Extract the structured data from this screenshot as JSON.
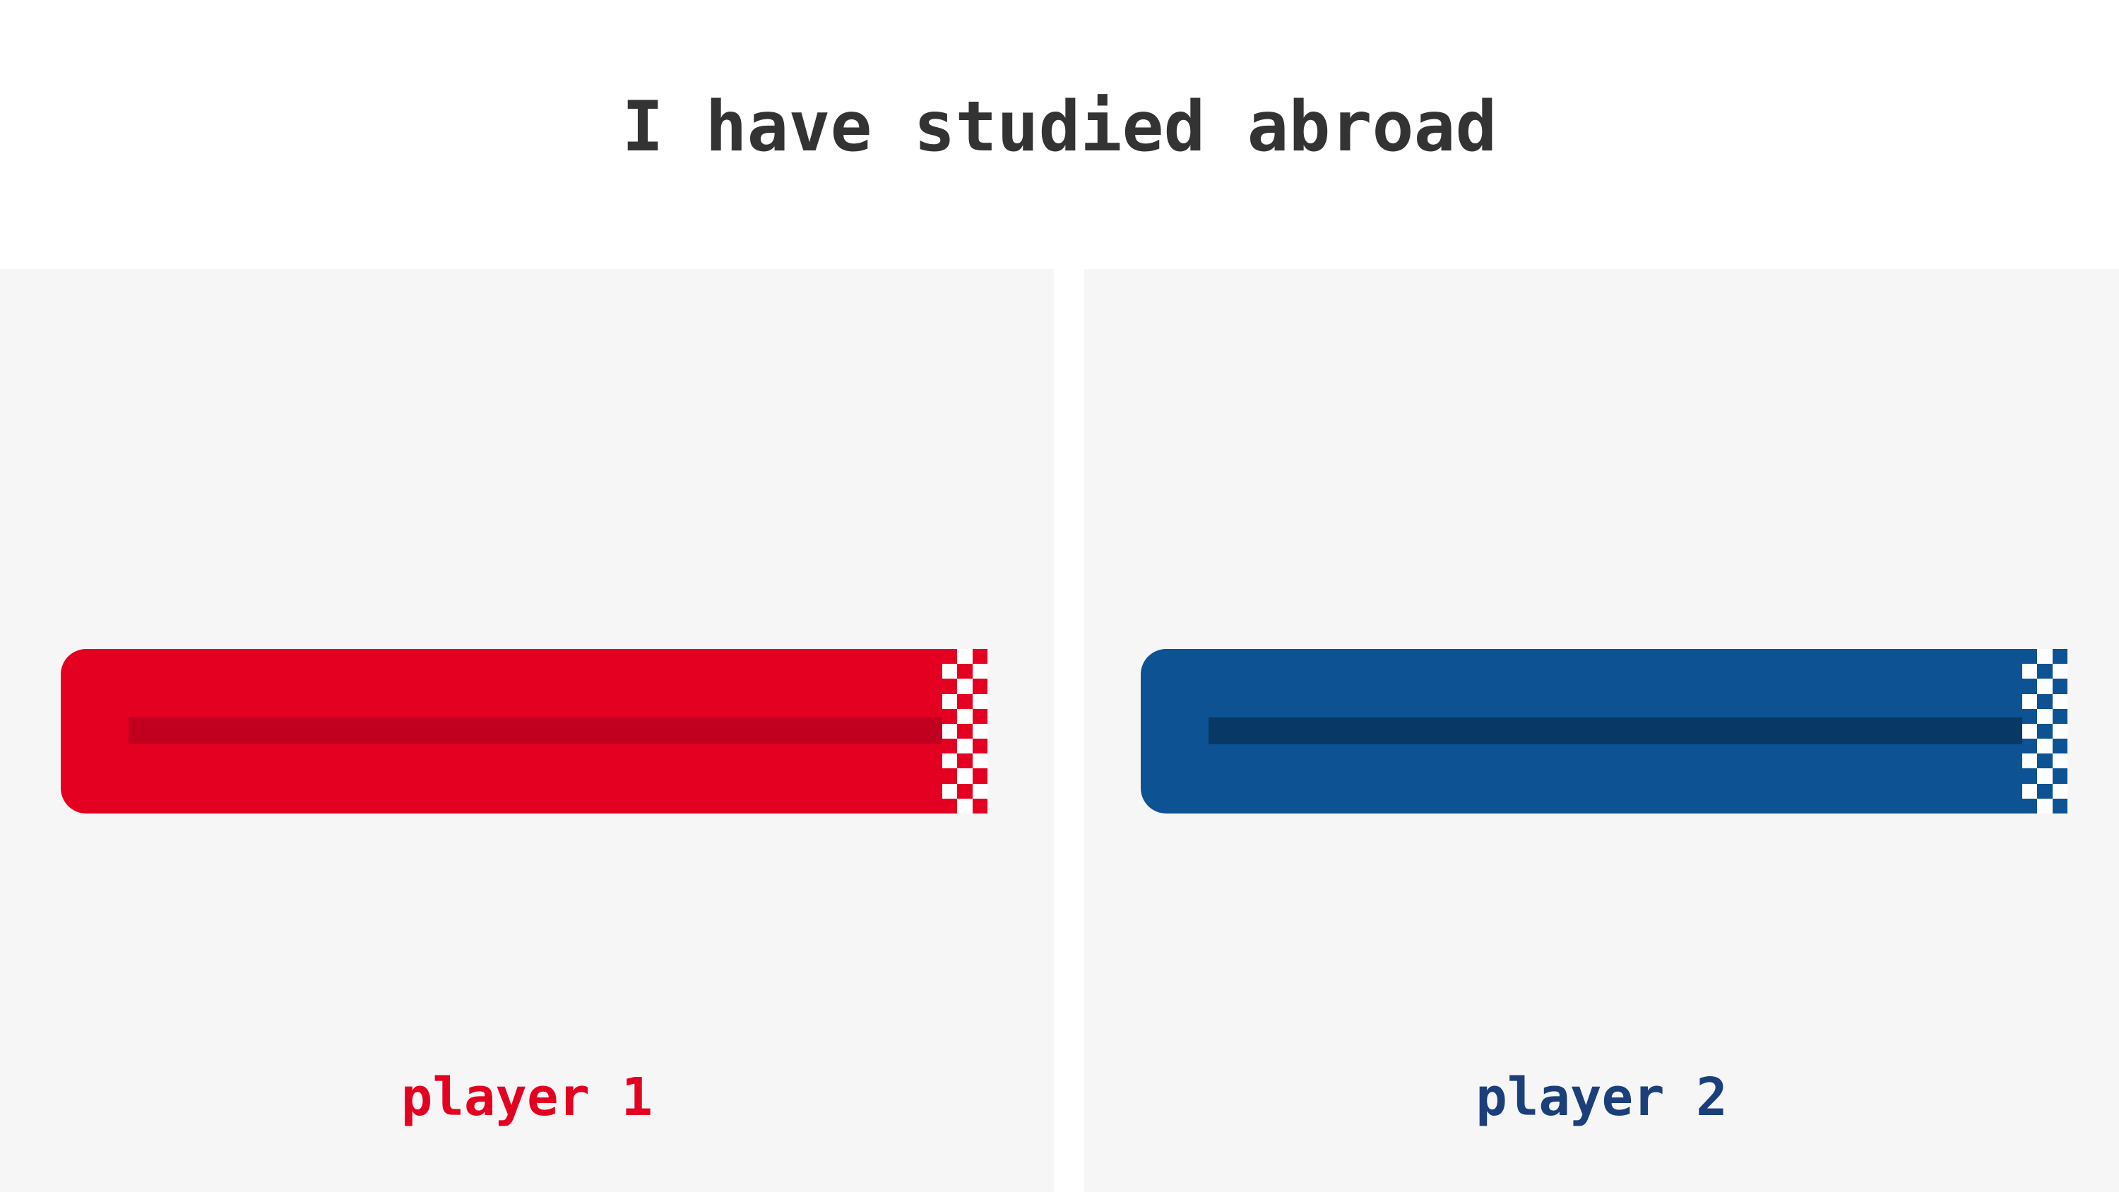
{
  "title": "I have studied abroad",
  "players": [
    {
      "label": "player 1",
      "progress": 1.0,
      "colors": {
        "track": "#e30020",
        "lane": "#c10020",
        "label": "#e30020",
        "checker": "#e30020"
      }
    },
    {
      "label": "player 2",
      "progress": 1.0,
      "colors": {
        "track": "#0d5293",
        "lane": "#083866",
        "label": "#1b3f7a",
        "checker": "#0d5293"
      }
    }
  ]
}
